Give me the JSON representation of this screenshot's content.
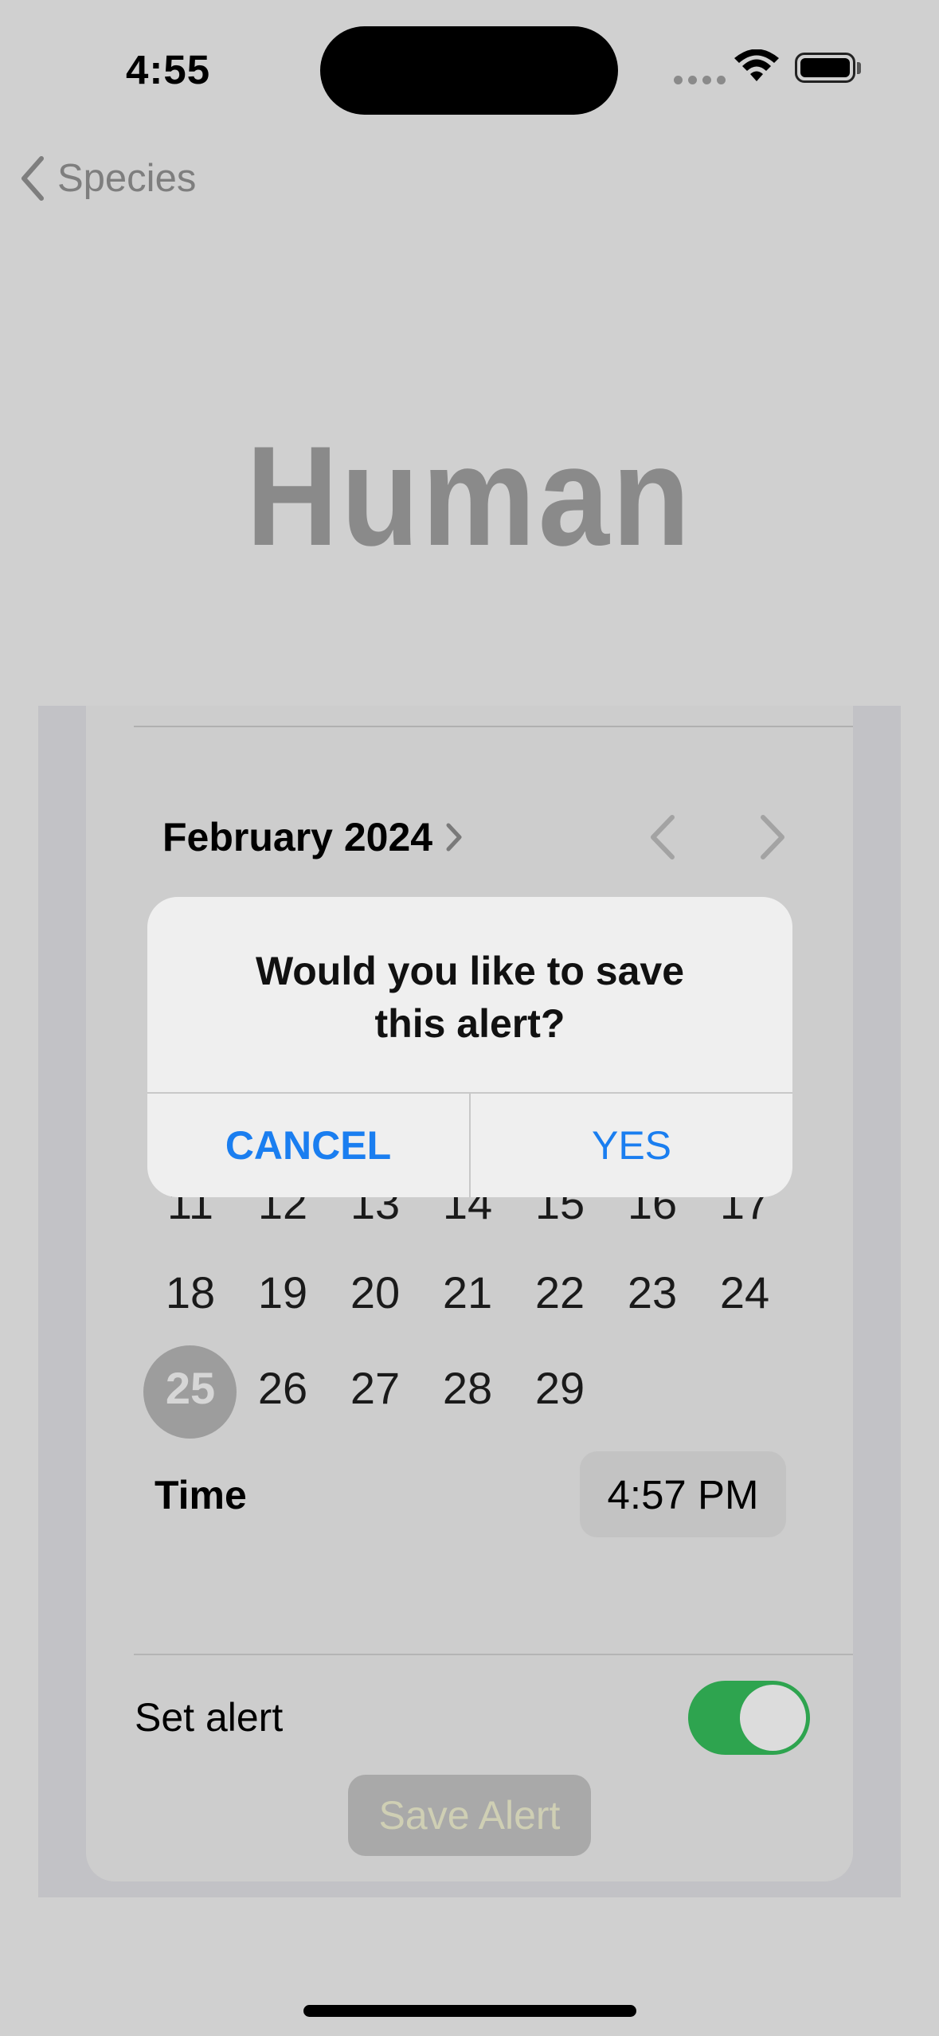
{
  "status": {
    "time": "4:55"
  },
  "nav": {
    "back_label": "Species"
  },
  "title": "Human",
  "calendar": {
    "month_label": "February 2024",
    "rows": [
      [
        "11",
        "12",
        "13",
        "14",
        "15",
        "16",
        "17"
      ],
      [
        "18",
        "19",
        "20",
        "21",
        "22",
        "23",
        "24"
      ],
      [
        "25",
        "26",
        "27",
        "28",
        "29"
      ]
    ],
    "selected_day": "25"
  },
  "time_row": {
    "label": "Time",
    "value": "4:57 PM"
  },
  "alert_row": {
    "label": "Set alert",
    "enabled": true
  },
  "save_button": {
    "label": "Save Alert"
  },
  "dialog": {
    "line1": "Would you like to save",
    "line2": "this alert?",
    "cancel_label": "CANCEL",
    "yes_label": "YES"
  },
  "colors": {
    "accent": "#1a7ef0",
    "toggle_on": "#2ea44f"
  }
}
